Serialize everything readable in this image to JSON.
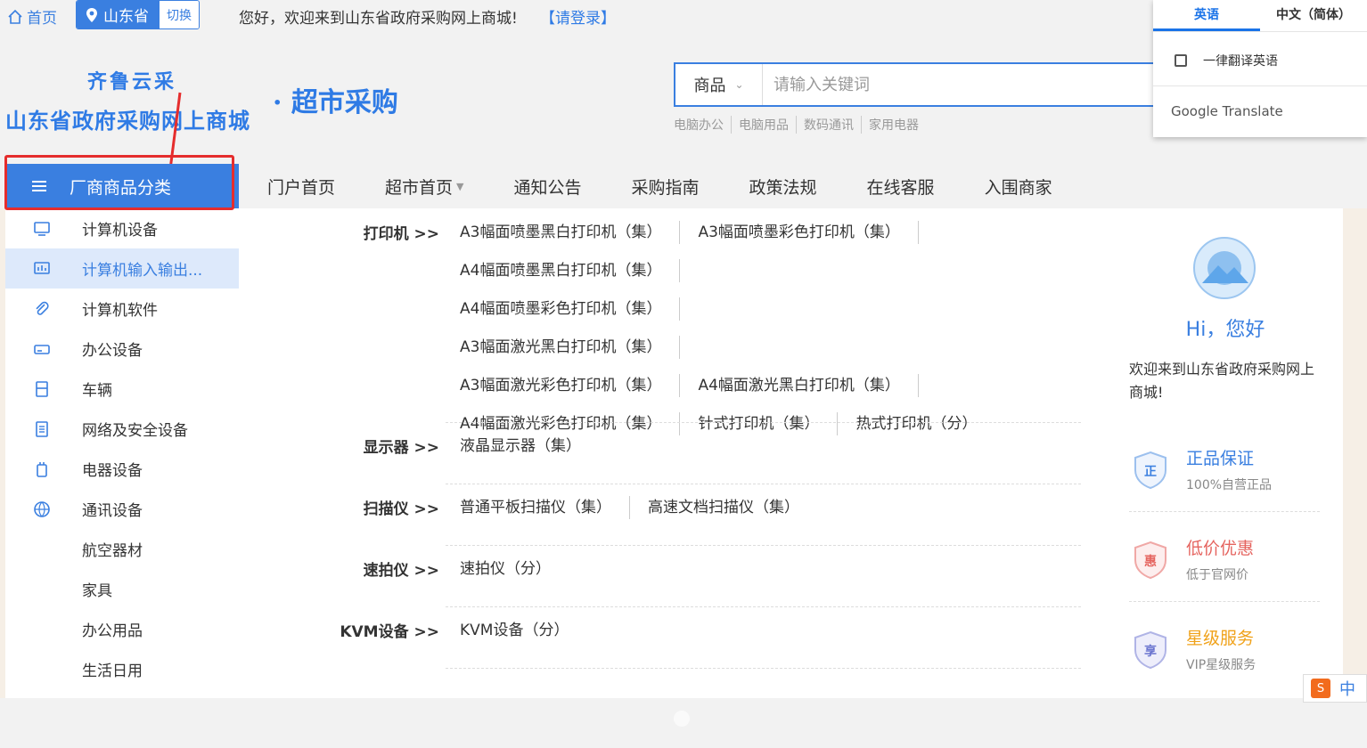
{
  "topbar": {
    "home_label": "首页",
    "province": "山东省",
    "switch_label": "切换",
    "welcome": "您好，欢迎来到山东省政府采购网上商城!",
    "login": "【请登录】"
  },
  "header": {
    "logo_top": "齐鲁云采",
    "logo_main": "山东省政府采购网上商城",
    "logo_sub": "· 超市采购",
    "search": {
      "category": "商品",
      "placeholder": "请输入关键词"
    },
    "hotwords": [
      "电脑办公",
      "电脑用品",
      "数码通讯",
      "家用电器"
    ]
  },
  "translate_popup": {
    "tab_english": "英语",
    "tab_chinese": "中文（简体）",
    "option_always": "一律翻译英语",
    "brand": "Google Translate"
  },
  "nav": {
    "category_button": "厂商商品分类",
    "items": [
      "门户首页",
      "超市首页",
      "通知公告",
      "采购指南",
      "政策法规",
      "在线客服",
      "入围商家"
    ]
  },
  "sidebar": {
    "items": [
      {
        "label": "计算机设备",
        "icon": "monitor-icon"
      },
      {
        "label": "计算机输入输出...",
        "icon": "chart-screen-icon"
      },
      {
        "label": "计算机软件",
        "icon": "paperclip-icon"
      },
      {
        "label": "办公设备",
        "icon": "printer-icon"
      },
      {
        "label": "车辆",
        "icon": "vehicle-icon"
      },
      {
        "label": "网络及安全设备",
        "icon": "document-icon"
      },
      {
        "label": "电器设备",
        "icon": "appliance-icon"
      },
      {
        "label": "通讯设备",
        "icon": "globe-icon"
      },
      {
        "label": "航空器材",
        "icon": ""
      },
      {
        "label": "家具",
        "icon": ""
      },
      {
        "label": "办公用品",
        "icon": ""
      },
      {
        "label": "生活日用",
        "icon": ""
      }
    ]
  },
  "flyout": {
    "groups": [
      {
        "title": "打印机 >>",
        "links": [
          "A3幅面喷墨黑白打印机（集）",
          "A3幅面喷墨彩色打印机（集）",
          "A4幅面喷墨黑白打印机（集）",
          "A4幅面喷墨彩色打印机（集）",
          "A3幅面激光黑白打印机（集）",
          "A3幅面激光彩色打印机（集）",
          "A4幅面激光黑白打印机（集）",
          "A4幅面激光彩色打印机（集）",
          "针式打印机（集）",
          "热式打印机（分）"
        ]
      },
      {
        "title": "显示器 >>",
        "links": [
          "液晶显示器（集）"
        ]
      },
      {
        "title": "扫描仪 >>",
        "links": [
          "普通平板扫描仪（集）",
          "高速文档扫描仪（集）"
        ]
      },
      {
        "title": "速拍仪 >>",
        "links": [
          "速拍仪（分）"
        ]
      },
      {
        "title": "KVM设备 >>",
        "links": [
          "KVM设备（分）"
        ]
      }
    ]
  },
  "right_panel": {
    "greeting": "Hi，您好",
    "welcome": "欢迎来到山东省政府采购网上商城!",
    "features": [
      {
        "badge": "正",
        "title": "正品保证",
        "subtitle": "100%自营正品",
        "color": "#3a7fe0"
      },
      {
        "badge": "惠",
        "title": "低价优惠",
        "subtitle": "低于官网价",
        "color": "#e5645f"
      },
      {
        "badge": "享",
        "title": "星级服务",
        "subtitle": "VIP星级服务",
        "color": "#f0a21a"
      }
    ]
  },
  "ime": {
    "label": "中"
  }
}
